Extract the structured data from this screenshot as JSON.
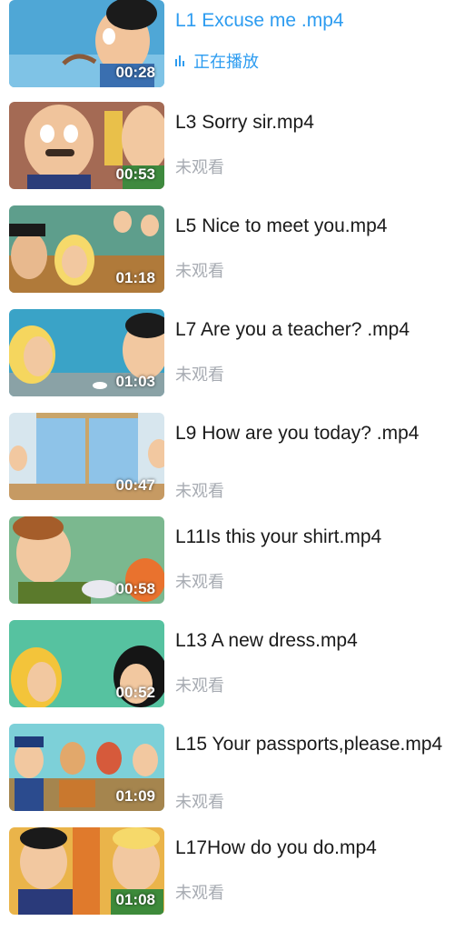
{
  "colors": {
    "accent": "#2d9cf0",
    "muted": "#a7abb2",
    "text": "#1a1a1a"
  },
  "playing_icon": "equalizer-icon",
  "videos": [
    {
      "title": "L1 Excuse me .mp4",
      "duration": "00:28",
      "status": "正在播放",
      "active": true
    },
    {
      "title": "L3 Sorry sir.mp4",
      "duration": "00:53",
      "status": "未观看",
      "active": false
    },
    {
      "title": "L5 Nice to meet you.mp4",
      "duration": "01:18",
      "status": "未观看",
      "active": false
    },
    {
      "title": "L7 Are you a teacher?  .mp4",
      "duration": "01:03",
      "status": "未观看",
      "active": false
    },
    {
      "title": "L9 How are you today?  .mp4",
      "duration": "00:47",
      "status": "未观看",
      "active": false
    },
    {
      "title": "L11Is this your shirt.mp4",
      "duration": "00:58",
      "status": "未观看",
      "active": false
    },
    {
      "title": "L13 A new dress.mp4",
      "duration": "00:52",
      "status": "未观看",
      "active": false
    },
    {
      "title": "L15 Your passports,please.mp4",
      "duration": "01:09",
      "status": "未观看",
      "active": false
    },
    {
      "title": "L17How do you do.mp4",
      "duration": "01:08",
      "status": "未观看",
      "active": false
    }
  ]
}
